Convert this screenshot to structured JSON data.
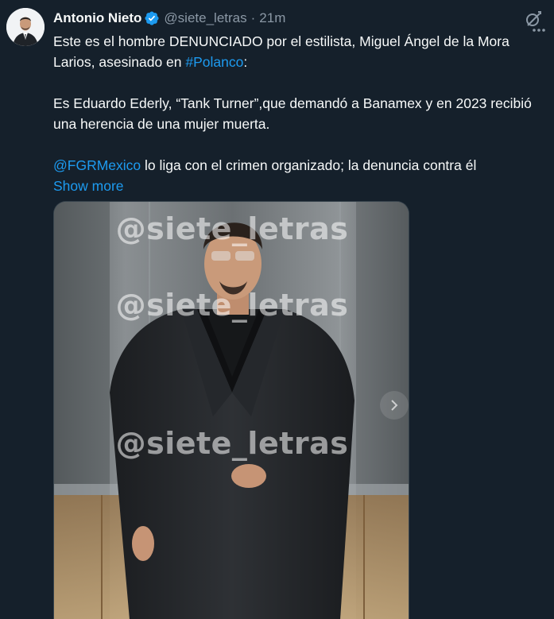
{
  "tweet": {
    "display_name": "Antonio Nieto",
    "handle": "@siete_letras",
    "separator": "·",
    "time": "21m",
    "lines": {
      "p1_before": "Este es el hombre DENUNCIADO por el estilista, Miguel Ángel de la Mora Larios, asesinado en ",
      "p1_hashtag": "#Polanco",
      "p1_after": ":",
      "p2": "Es Eduardo Ederly, “Tank Turner”,que demandó a Banamex y en 2023 recibió una herencia de una mujer muerta.",
      "p3_mention": "@FGRMexico",
      "p3_after": " lo liga con el crimen organizado; la denuncia contra él"
    },
    "show_more": "Show more"
  },
  "media": {
    "watermark": "@siete_letras"
  },
  "colors": {
    "background": "#15202b",
    "text": "#f7f9f9",
    "secondary": "#8b98a5",
    "link": "#1d9bf0",
    "verified": "#1d9bf0"
  },
  "icons": {
    "verified": "verified-badge-icon",
    "grok": "grok-icon",
    "more": "more-options-icon",
    "next": "chevron-right-icon"
  }
}
